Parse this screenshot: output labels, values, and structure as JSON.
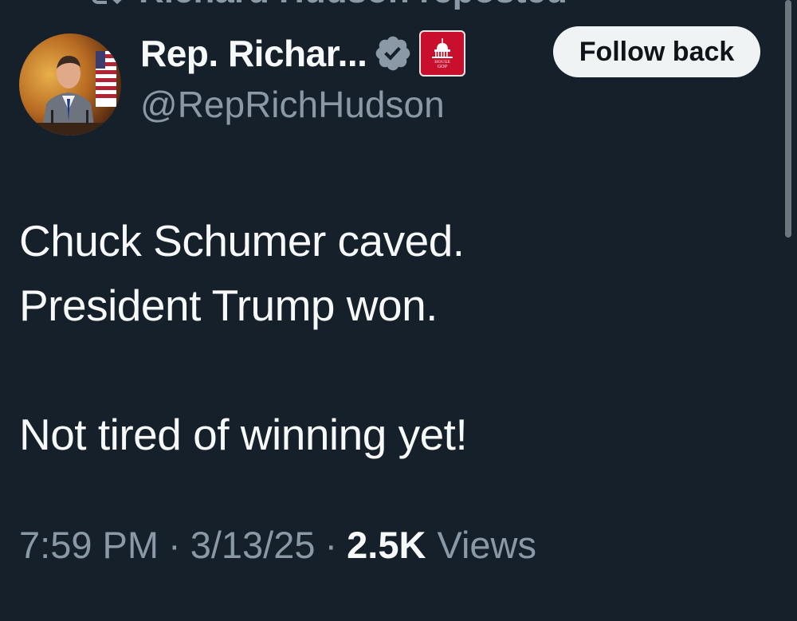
{
  "repost": {
    "text": "Richard Hudson reposted",
    "icon": "repost-icon"
  },
  "author": {
    "display_name": "Rep. Richar...",
    "handle": "@RepRichHudson",
    "verified_icon": "verified-badge-icon",
    "affiliation_badge": {
      "icon": "capitol-dome-icon",
      "text_top": "HOUSE",
      "text_bottom": "GOP",
      "color": "#c8102e"
    }
  },
  "follow_button": {
    "label": "Follow back"
  },
  "tweet": {
    "lines": [
      "Chuck Schumer caved.",
      "President Trump won.",
      "",
      "Not tired of winning yet!"
    ]
  },
  "meta": {
    "time": "7:59 PM",
    "separator": "·",
    "date": "3/13/25",
    "views_count": "2.5K",
    "views_label": "Views"
  },
  "colors": {
    "background": "#15202b",
    "primary_text": "#f7f9f9",
    "secondary_text": "#8b98a5",
    "verified": "#8b98a5"
  }
}
